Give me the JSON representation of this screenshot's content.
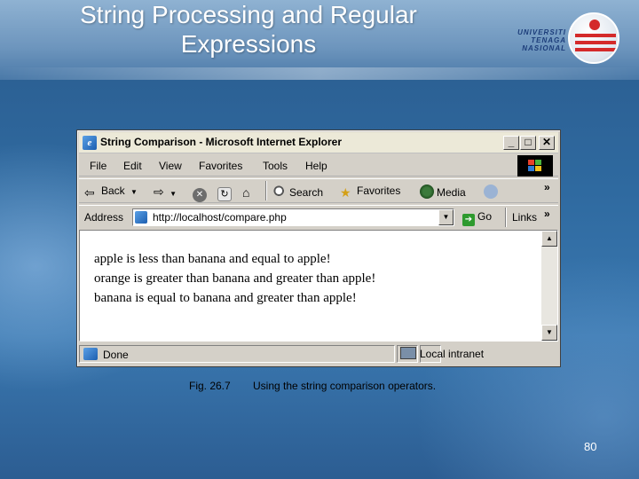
{
  "slide": {
    "title_line1": "String Processing and Regular",
    "title_line2": "Expressions",
    "logo_text": [
      "UNIVERSITI",
      "TENAGA",
      "NASIONAL"
    ],
    "figure_label": "Fig. 26.7",
    "caption": "Using the string comparison operators.",
    "page_number": "80"
  },
  "window": {
    "title": "String Comparison - Microsoft Internet Explorer",
    "buttons": {
      "minimize": "_",
      "maximize": "□",
      "close": "✕"
    }
  },
  "menu": {
    "items": [
      "File",
      "Edit",
      "View",
      "Favorites",
      "Tools",
      "Help"
    ]
  },
  "toolbar": {
    "back_label": "Back",
    "search_label": "Search",
    "favorites_label": "Favorites",
    "media_label": "Media",
    "more": "»"
  },
  "address": {
    "label": "Address",
    "url": "http://localhost/compare.php",
    "go_label": "Go",
    "links_label": "Links",
    "more": "»"
  },
  "content": {
    "lines": [
      "apple is less than banana and equal to apple!",
      "orange is greater than banana and greater than apple!",
      "banana is equal to banana and greater than apple!"
    ]
  },
  "status": {
    "left": "Done",
    "zone": "Local intranet"
  },
  "colors": {
    "title_bar": "#ece9d8",
    "chrome": "#d4d0c8",
    "slide_bg": "#2f6aa0",
    "logo_red": "#d42a2a",
    "logo_blue": "#1c3d7a"
  }
}
